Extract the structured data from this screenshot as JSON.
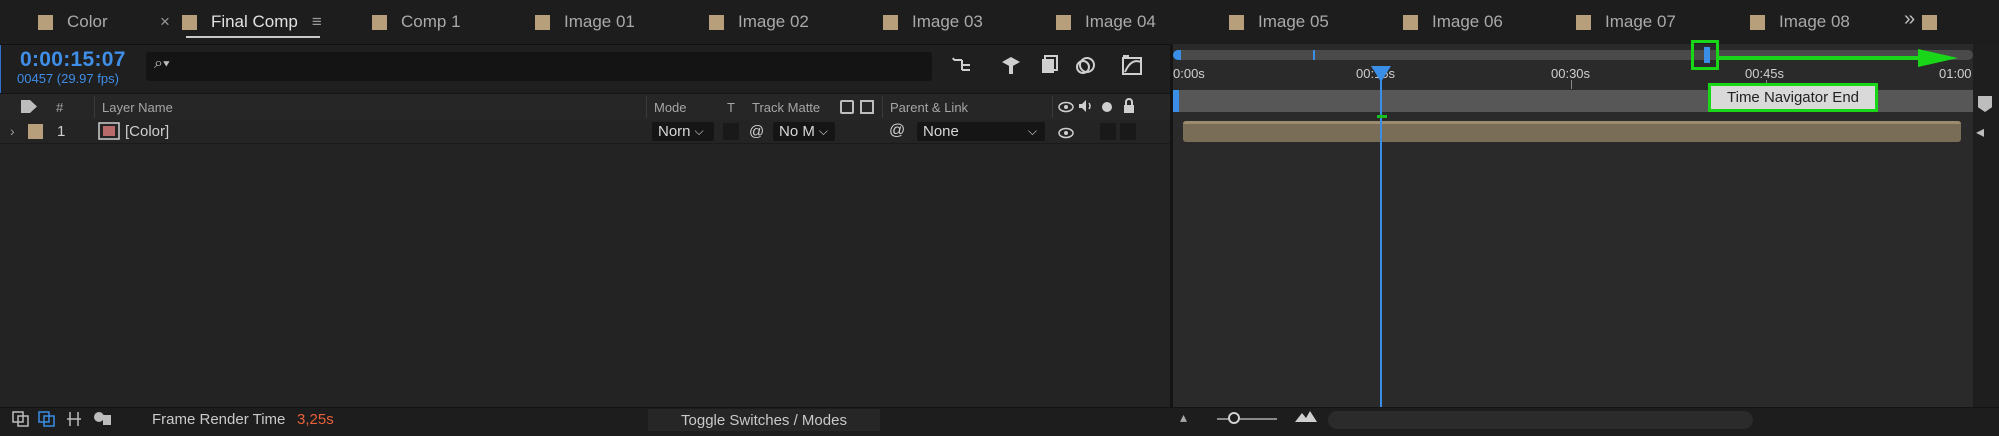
{
  "tabs": [
    {
      "label": "Color",
      "active": false,
      "closable": false
    },
    {
      "label": "Final Comp",
      "active": true,
      "closable": true
    },
    {
      "label": "Comp 1",
      "active": false,
      "closable": false
    },
    {
      "label": "Image 01",
      "active": false,
      "closable": false
    },
    {
      "label": "Image 02",
      "active": false,
      "closable": false
    },
    {
      "label": "Image 03",
      "active": false,
      "closable": false
    },
    {
      "label": "Image 04",
      "active": false,
      "closable": false
    },
    {
      "label": "Image 05",
      "active": false,
      "closable": false
    },
    {
      "label": "Image 06",
      "active": false,
      "closable": false
    },
    {
      "label": "Image 07",
      "active": false,
      "closable": false
    },
    {
      "label": "Image 08",
      "active": false,
      "closable": false
    }
  ],
  "close_glyph": "×",
  "menu_glyph": "≡",
  "overflow_glyph": "»",
  "timecode": "0:00:15:07",
  "frames": "00457 (29.97 fps)",
  "search": {
    "placeholder": "",
    "icon": "search-icon"
  },
  "columns": {
    "hash": "#",
    "layer_name": "Layer Name",
    "mode": "Mode",
    "t": "T",
    "track_matte": "Track Matte",
    "parent_link": "Parent & Link"
  },
  "layer": {
    "number": "1",
    "name": "[Color]",
    "mode": "Norn",
    "track_matte": "No M",
    "parent": "None"
  },
  "ruler": {
    "labels": [
      "0:00s",
      "00:15s",
      "00:30s",
      "00:45s",
      "01:00"
    ]
  },
  "tooltip": "Time Navigator End",
  "bottom": {
    "render_label": "Frame Render Time",
    "render_value": "3,25s",
    "toggle_label": "Toggle Switches / Modes"
  },
  "colors": {
    "accent": "#3a8ee6",
    "highlight": "#19d619",
    "layer_label": "#b79f7c",
    "render_time": "#e8603a"
  }
}
